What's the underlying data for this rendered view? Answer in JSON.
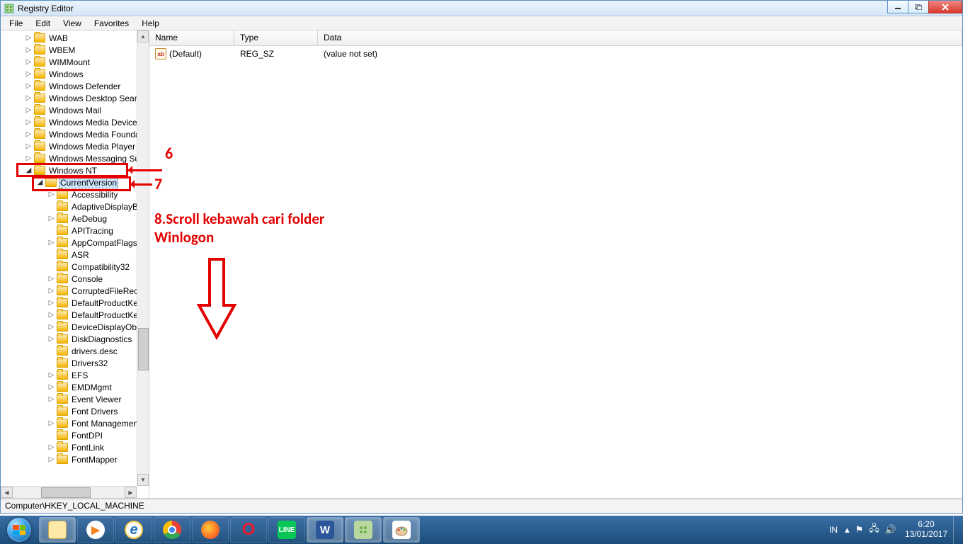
{
  "window": {
    "title": "Registry Editor"
  },
  "menu": {
    "file": "File",
    "edit": "Edit",
    "view": "View",
    "favorites": "Favorites",
    "help": "Help"
  },
  "tree": {
    "items_top": [
      "WAB",
      "WBEM",
      "WIMMount",
      "Windows",
      "Windows Defender",
      "Windows Desktop Search",
      "Windows Mail",
      "Windows Media Device M",
      "Windows Media Foundat",
      "Windows Media Player N",
      "Windows Messaging Sub"
    ],
    "nt": "Windows NT",
    "cv": "CurrentVersion",
    "children": [
      "Accessibility",
      "AdaptiveDisplayB",
      "AeDebug",
      "APITracing",
      "AppCompatFlags",
      "ASR",
      "Compatibility32",
      "Console",
      "CorruptedFileRec",
      "DefaultProductKe",
      "DefaultProductKe",
      "DeviceDisplayObj",
      "DiskDiagnostics",
      "drivers.desc",
      "Drivers32",
      "EFS",
      "EMDMgmt",
      "Event Viewer",
      "Font Drivers",
      "Font Management",
      "FontDPI",
      "FontLink",
      "FontMapper"
    ],
    "child_exp": [
      "t",
      "f",
      "t",
      "f",
      "t",
      "f",
      "f",
      "t",
      "t",
      "t",
      "t",
      "t",
      "t",
      "f",
      "f",
      "t",
      "t",
      "t",
      "f",
      "t",
      "f",
      "t",
      "t"
    ]
  },
  "list": {
    "headers": {
      "name": "Name",
      "type": "Type",
      "data": "Data"
    },
    "row": {
      "name": "(Default)",
      "type": "REG_SZ",
      "data": "(value not set)"
    }
  },
  "status": {
    "path": "Computer\\HKEY_LOCAL_MACHINE"
  },
  "annotations": {
    "n6": "6",
    "n7": "7",
    "text": "8.Scroll kebawah cari folder Winlogon"
  },
  "taskbar": {
    "lang": "IN",
    "time": "6:20",
    "date": "13/01/2017",
    "apps": [
      "explorer",
      "wmp",
      "ie",
      "chrome",
      "firefox",
      "opera",
      "line",
      "word",
      "regedit",
      "paint"
    ]
  }
}
